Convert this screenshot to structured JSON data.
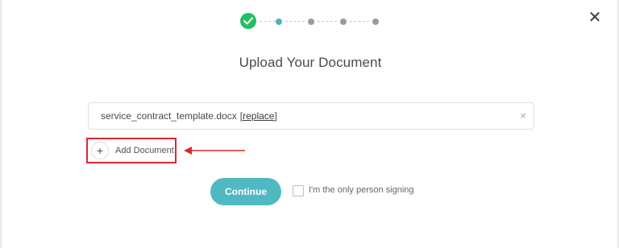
{
  "modal": {
    "close_glyph": "✕",
    "stepper": {
      "total_steps": 5,
      "completed_steps": 1,
      "current_step": 2
    },
    "title": "Upload Your Document",
    "file": {
      "name": "service_contract_template.docx",
      "replace_open": "[",
      "replace_label": "replace",
      "replace_close": "]",
      "remove_glyph": "×"
    },
    "add_document": {
      "plus_glyph": "+",
      "label": "Add Document"
    },
    "continue_label": "Continue",
    "only_signer_label": "I'm the only person signing"
  },
  "colors": {
    "accent": "#4fb8c3",
    "success": "#22c064",
    "highlight_box": "#e0262c",
    "active_step": "#48b3c1"
  },
  "icons": [
    "close-icon",
    "check-icon",
    "remove-icon",
    "plus-icon",
    "arrow-left-icon"
  ]
}
